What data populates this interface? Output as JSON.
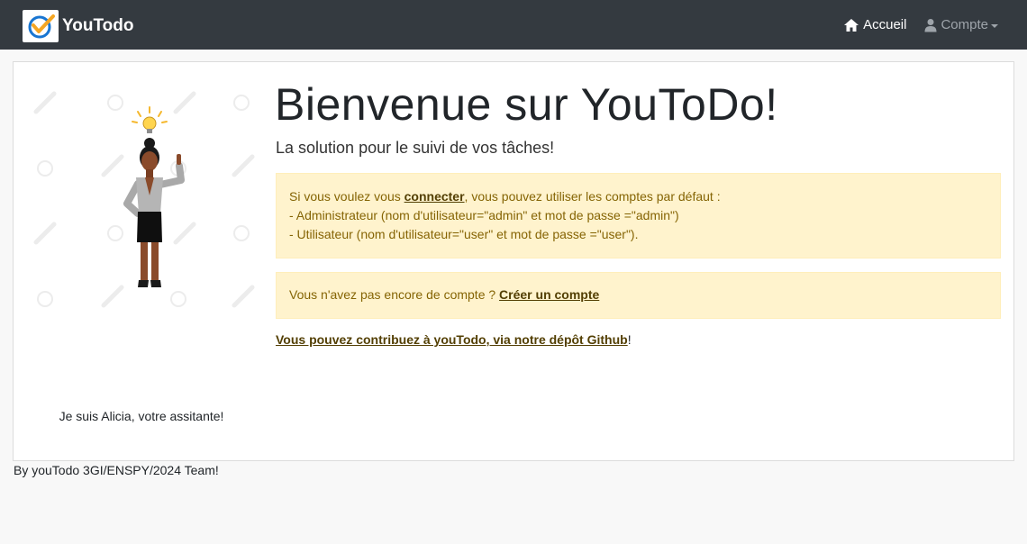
{
  "navbar": {
    "brand": "YouTodo",
    "home_label": "Accueil",
    "account_label": "Compte"
  },
  "assistant": {
    "caption": "Je suis Alicia, votre assitante!"
  },
  "main": {
    "title": "Bienvenue sur YouToDo!",
    "subtitle": "La solution pour le suivi de vos tâches!",
    "info": {
      "line1_prefix": "Si vous voulez vous ",
      "line1_link": "connecter",
      "line1_suffix": ", vous pouvez utiliser les comptes par défaut :",
      "line2": "- Administrateur (nom d'utilisateur=\"admin\" et mot de passe =\"admin\")",
      "line3": "- Utilisateur (nom d'utilisateur=\"user\" et mot de passe =\"user\")."
    },
    "signup": {
      "prefix": "Vous n'avez pas encore de compte ? ",
      "link": "Créer un compte"
    },
    "github": {
      "link": "Vous pouvez contribuez à youTodo, via notre dépôt Github",
      "suffix": "!"
    }
  },
  "footer": {
    "text": "By youTodo 3GI/ENSPY/2024 Team!"
  }
}
